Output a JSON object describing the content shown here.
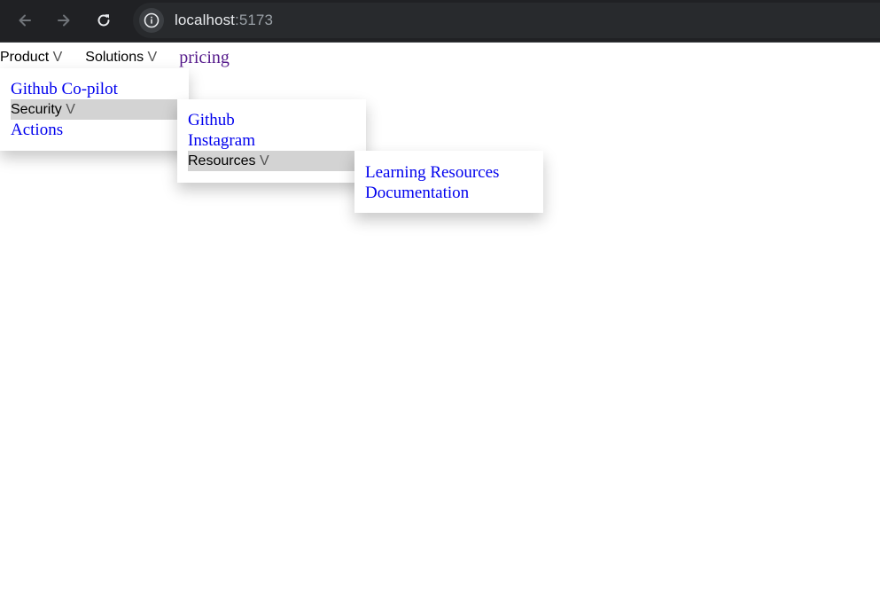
{
  "browser": {
    "url_host": "localhost",
    "url_port": ":5173",
    "icons": [
      "back-arrow-icon",
      "forward-arrow-icon",
      "reload-icon",
      "info-icon"
    ]
  },
  "nav": {
    "product_label": "Product",
    "solutions_label": "Solutions",
    "pricing_label": "pricing",
    "caret": "V"
  },
  "menu_product": {
    "item1": "Github Co-pilot",
    "security_label": "Security",
    "item3": "Actions"
  },
  "menu_security": {
    "item1": "Github",
    "item2": "Instagram",
    "resources_label": "Resources"
  },
  "menu_resources": {
    "item1": "Learning Resources",
    "item2": "Documentation"
  },
  "colors": {
    "chrome_bg": "#202124",
    "link": "#0000ee",
    "visited_link": "#551a8b",
    "submenu_highlight": "#d3d3d3"
  }
}
